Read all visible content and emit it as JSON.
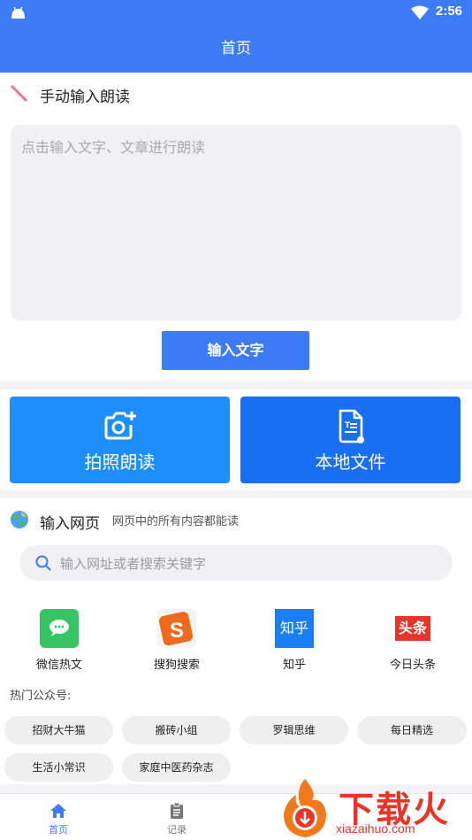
{
  "status_bar": {
    "time": "2:56"
  },
  "header": {
    "title": "首页"
  },
  "manual": {
    "title": "手动输入朗读",
    "placeholder": "点击输入文字、文章进行朗读",
    "button": "输入文字"
  },
  "features": [
    {
      "label": "拍照朗读",
      "icon": "camera-plus-icon",
      "color": "#1e8ffa"
    },
    {
      "label": "本地文件",
      "icon": "document-icon",
      "color": "#1a6ff0"
    }
  ],
  "web": {
    "title": "输入网页",
    "subtitle": "网页中的所有内容都能读",
    "search_placeholder": "输入网址或者搜索关键字",
    "sites": [
      {
        "name": "微信热文",
        "icon": "wechat-icon",
        "logo_text": ""
      },
      {
        "name": "搜狗搜索",
        "icon": "sogou-icon",
        "logo_text": "S"
      },
      {
        "name": "知乎",
        "icon": "zhihu-icon",
        "logo_text": "知乎"
      },
      {
        "name": "今日头条",
        "icon": "toutiao-icon",
        "logo_text": "头条"
      }
    ]
  },
  "hot": {
    "label": "热门公众号:",
    "chips": [
      "招财大牛猫",
      "搬砖小组",
      "罗辑思维",
      "每日精选",
      "生活小常识",
      "家庭中医药杂志"
    ]
  },
  "tabs": [
    {
      "label": "首页",
      "icon": "home-icon",
      "active": true
    },
    {
      "label": "记录",
      "icon": "clipboard-icon",
      "active": false
    }
  ],
  "watermark": {
    "text": "下载火",
    "url": "xiazaihuo.com"
  },
  "colors": {
    "primary": "#3d7bf7",
    "tile_left": "#1e8ffa",
    "tile_right": "#1a6ff0",
    "watermark": "#e8352a"
  }
}
